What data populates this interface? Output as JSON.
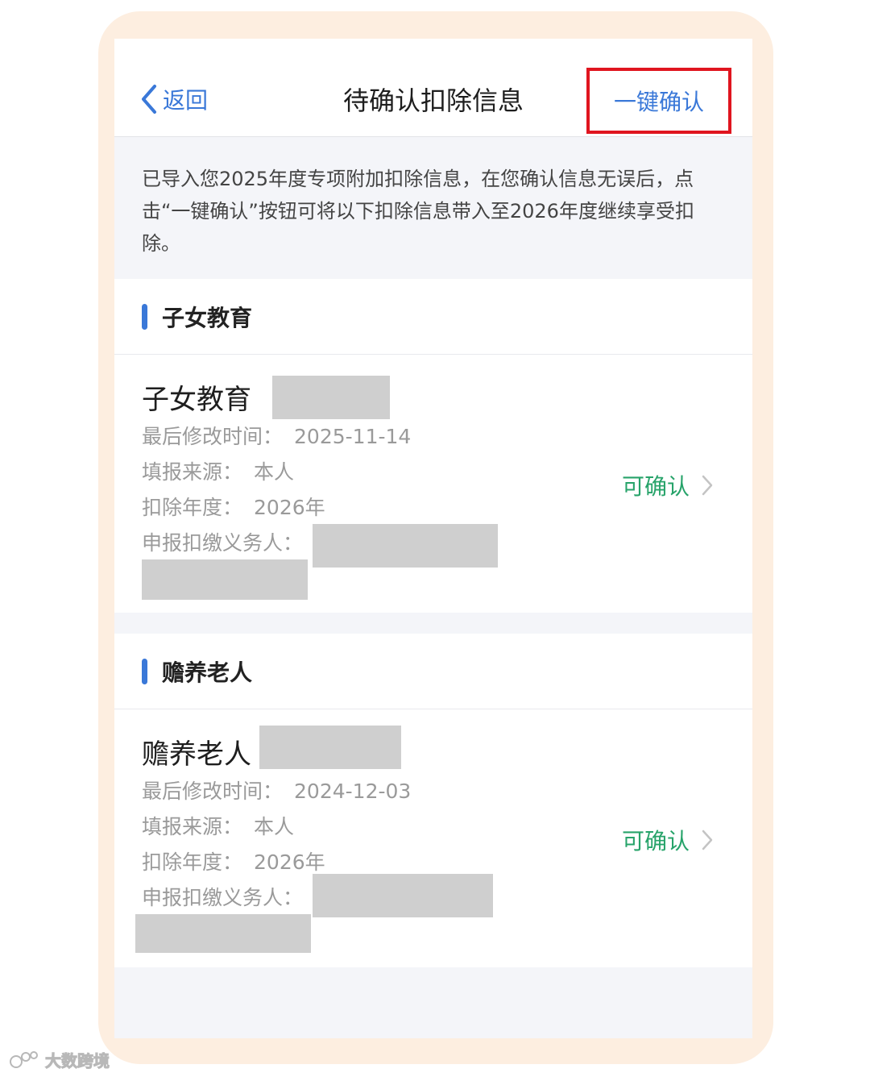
{
  "header": {
    "back_label": "返回",
    "title": "待确认扣除信息",
    "confirm_label": "一键确认"
  },
  "notice": "已导入您2025年度专项附加扣除信息，在您确认信息无误后，点击“一键确认”按钮可将以下扣除信息带入至2026年度继续享受扣除。",
  "sections": [
    {
      "title": "子女教育",
      "item": {
        "name": "子女教育",
        "modified_label": "最后修改时间：",
        "modified_value": "2025-11-14",
        "source_label": "填报来源：",
        "source_value": "本人",
        "year_label": "扣除年度：",
        "year_value": "2026年",
        "payer_label": "申报扣缴义务人：",
        "status": "可确认"
      }
    },
    {
      "title": "赡养老人",
      "item": {
        "name": "赡养老人",
        "modified_label": "最后修改时间：",
        "modified_value": "2024-12-03",
        "source_label": "填报来源：",
        "source_value": "本人",
        "year_label": "扣除年度：",
        "year_value": "2026年",
        "payer_label": "申报扣缴义务人：",
        "status": "可确认"
      }
    }
  ],
  "watermark": "大数跨境",
  "colors": {
    "accent": "#3a78d8",
    "status_green": "#27a36a",
    "highlight_red": "#e0151f",
    "frame": "#fdeee0"
  }
}
